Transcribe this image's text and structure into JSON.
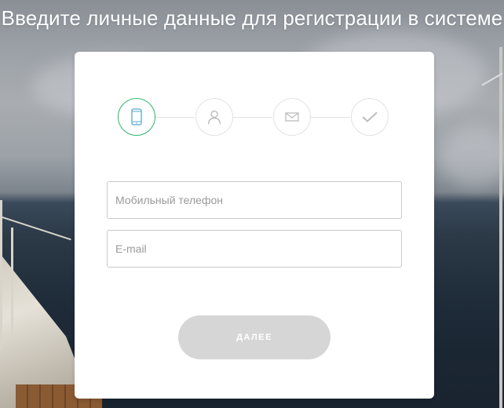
{
  "page": {
    "title": "Введите личные данные для регистрации в системе"
  },
  "steps": [
    {
      "icon": "phone-icon",
      "state": "active"
    },
    {
      "icon": "user-icon",
      "state": "inactive"
    },
    {
      "icon": "envelope-icon",
      "state": "inactive"
    },
    {
      "icon": "checkmark-icon",
      "state": "inactive"
    }
  ],
  "form": {
    "phone_placeholder": "Мобильный телефон",
    "phone_value": "",
    "email_placeholder": "E-mail",
    "email_value": "",
    "next_label": "ДАЛЕЕ"
  },
  "colors": {
    "accent": "#2bb673",
    "step_inactive": "#e2e2e2",
    "button_disabled": "#d6d6d6"
  }
}
